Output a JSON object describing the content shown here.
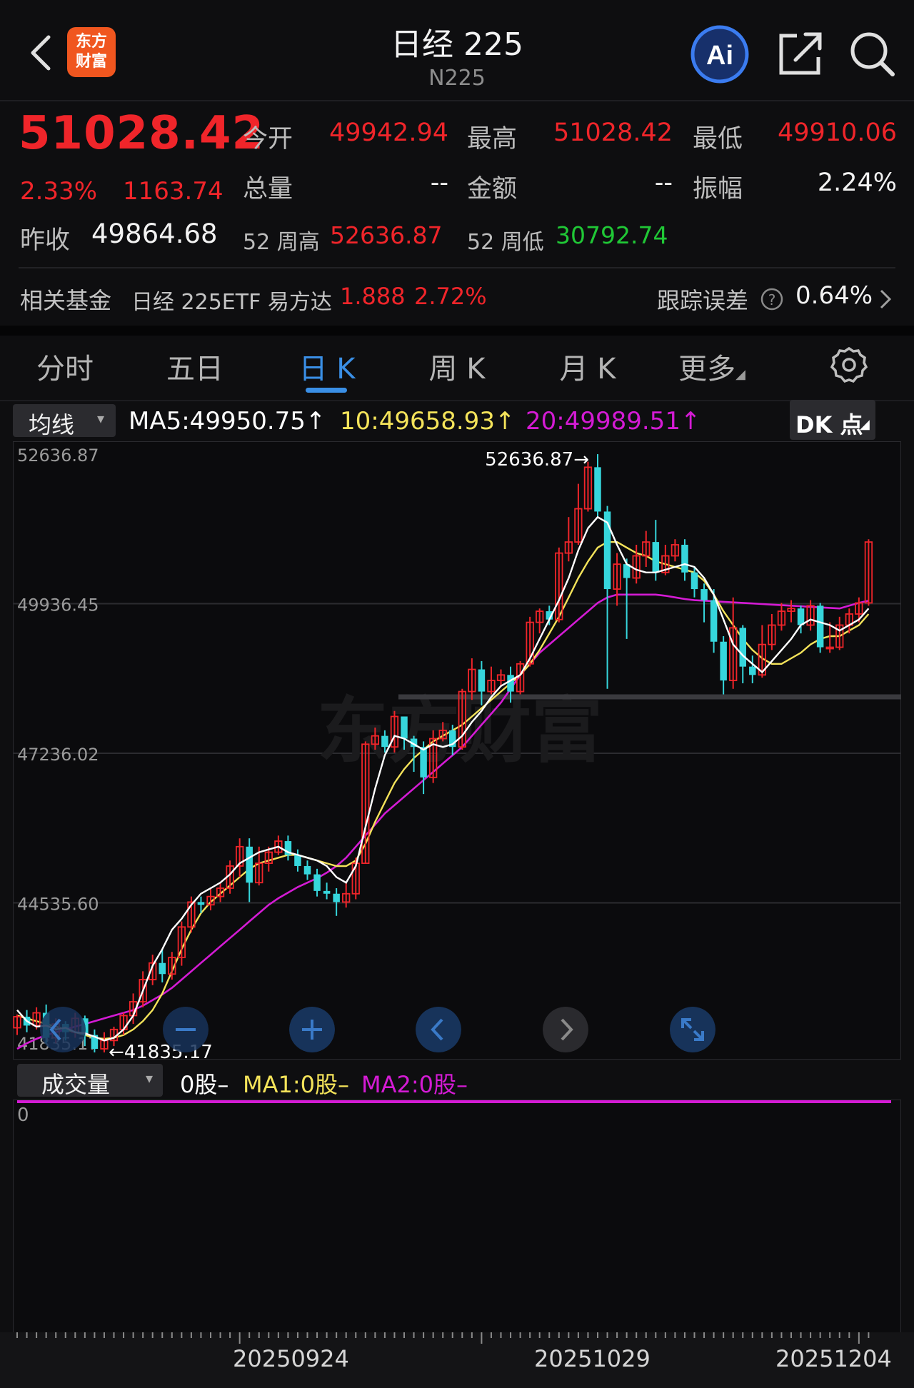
{
  "header": {
    "title": "日经 225",
    "subtitle": "N225",
    "logo_line1": "东方",
    "logo_line2": "财富",
    "ai_label": "Ai"
  },
  "quote": {
    "price": "51028.42",
    "change_pct": "2.33%",
    "change_abs": "1163.74",
    "open_label": "今开",
    "open": "49942.94",
    "high_label": "最高",
    "high": "51028.42",
    "low_label": "最低",
    "low": "49910.06",
    "volume_label": "总量",
    "volume": "--",
    "amount_label": "金额",
    "amount": "--",
    "amplitude_label": "振幅",
    "amplitude": "2.24%",
    "prev_close_label": "昨收",
    "prev_close": "49864.68",
    "w52_high_label": "52 周高",
    "w52_high": "52636.87",
    "w52_low_label": "52 周低",
    "w52_low": "30792.74"
  },
  "fund": {
    "label": "相关基金",
    "name": "日经 225ETF 易方达",
    "price": "1.888",
    "change": "2.72%",
    "tracking_label": "跟踪误差",
    "tracking_value": "0.64%"
  },
  "tabs": [
    "分时",
    "五日",
    "日 K",
    "周 K",
    "月 K",
    "更多"
  ],
  "active_tab": "日 K",
  "ma_bar": {
    "select": "均线",
    "ma5": "MA5:49950.75",
    "ma10": "10:49658.93",
    "ma20": "20:49989.51",
    "dk_button": "DK 点"
  },
  "colors": {
    "up": "#f0252a",
    "down": "#36d6dc",
    "ma5": "#ffffff",
    "ma10": "#f4e35a",
    "ma20": "#d41bd4",
    "accent": "#3a8fe6"
  },
  "chart_data": {
    "type": "candlestick",
    "y_labels": [
      "52636.87",
      "49936.45",
      "47236.02",
      "44535.60",
      "41835.17"
    ],
    "ylim": [
      41835.17,
      52636.87
    ],
    "max_annotation": "52636.87",
    "min_annotation": "41835.17",
    "x_labels": [
      "20250924",
      "20251029",
      "20251204"
    ],
    "candles": [
      [
        42280,
        42480,
        42150,
        42520
      ],
      [
        42480,
        42320,
        42200,
        42600
      ],
      [
        42320,
        42550,
        42250,
        42650
      ],
      [
        42550,
        42100,
        42000,
        42700
      ],
      [
        42100,
        42350,
        42000,
        42450
      ],
      [
        42350,
        42200,
        42050,
        42400
      ],
      [
        42200,
        42450,
        42100,
        42550
      ],
      [
        42450,
        42150,
        41950,
        42500
      ],
      [
        42150,
        41900,
        41835,
        42250
      ],
      [
        41900,
        42050,
        41835,
        42200
      ],
      [
        42050,
        42250,
        41950,
        42300
      ],
      [
        42250,
        42500,
        42150,
        42550
      ],
      [
        42500,
        42750,
        42350,
        42900
      ],
      [
        42750,
        43150,
        42650,
        43300
      ],
      [
        43150,
        43450,
        43050,
        43600
      ],
      [
        43450,
        43250,
        43100,
        43700
      ],
      [
        43250,
        43550,
        43150,
        43650
      ],
      [
        43550,
        44100,
        43400,
        44200
      ],
      [
        44100,
        44550,
        44000,
        44650
      ],
      [
        44550,
        44500,
        44350,
        44650
      ],
      [
        44500,
        44650,
        44400,
        44800
      ],
      [
        44650,
        44800,
        44550,
        44900
      ],
      [
        44800,
        45200,
        44700,
        45300
      ],
      [
        45200,
        45550,
        45000,
        45700
      ],
      [
        45550,
        44900,
        44550,
        45700
      ],
      [
        44900,
        45250,
        44850,
        45550
      ],
      [
        45250,
        45450,
        45100,
        45550
      ],
      [
        45450,
        45650,
        45400,
        45750
      ],
      [
        45650,
        45400,
        45300,
        45750
      ],
      [
        45400,
        45200,
        45100,
        45500
      ],
      [
        45200,
        45050,
        44950,
        45300
      ],
      [
        45050,
        44750,
        44650,
        45150
      ],
      [
        44750,
        44700,
        44600,
        44900
      ],
      [
        44700,
        44550,
        44300,
        44800
      ],
      [
        44550,
        44700,
        44450,
        44900
      ],
      [
        44700,
        45250,
        44600,
        45350
      ],
      [
        45250,
        47400,
        45250,
        47450
      ],
      [
        47400,
        47550,
        47300,
        47700
      ],
      [
        47550,
        47350,
        47250,
        47650
      ],
      [
        47350,
        47900,
        47250,
        48000
      ],
      [
        47900,
        47500,
        47300,
        47900
      ],
      [
        47500,
        47350,
        46900,
        47550
      ],
      [
        47350,
        46800,
        46500,
        47450
      ],
      [
        46800,
        47500,
        46700,
        47650
      ],
      [
        47500,
        47650,
        47450,
        47800
      ],
      [
        47650,
        47350,
        47200,
        47750
      ],
      [
        47350,
        48350,
        47300,
        48400
      ],
      [
        48350,
        48750,
        48200,
        48950
      ],
      [
        48750,
        48350,
        48100,
        48900
      ],
      [
        48350,
        48550,
        48300,
        48800
      ],
      [
        48550,
        48650,
        48450,
        48750
      ],
      [
        48650,
        48350,
        48150,
        48800
      ],
      [
        48350,
        48850,
        48300,
        48900
      ],
      [
        48850,
        49600,
        48800,
        49700
      ],
      [
        49600,
        49800,
        49400,
        49850
      ],
      [
        49800,
        49650,
        49550,
        49900
      ],
      [
        49650,
        50850,
        49600,
        50950
      ],
      [
        50850,
        51050,
        50700,
        51500
      ],
      [
        51050,
        51650,
        51000,
        52100
      ],
      [
        51650,
        52400,
        51600,
        52500
      ],
      [
        52400,
        51600,
        51500,
        52636
      ],
      [
        51600,
        50200,
        48400,
        51700
      ],
      [
        50200,
        50650,
        49900,
        50850
      ],
      [
        50650,
        50400,
        49300,
        50750
      ],
      [
        50400,
        50800,
        50300,
        51000
      ],
      [
        50800,
        51050,
        50600,
        51250
      ],
      [
        51050,
        50500,
        50350,
        51450
      ],
      [
        50500,
        50800,
        50450,
        51000
      ],
      [
        50800,
        51000,
        50700,
        51100
      ],
      [
        51000,
        50500,
        50350,
        51100
      ],
      [
        50500,
        50200,
        50050,
        50600
      ],
      [
        50200,
        50000,
        49600,
        50300
      ],
      [
        50000,
        49250,
        49050,
        50200
      ],
      [
        49250,
        48550,
        48300,
        49350
      ],
      [
        48550,
        49500,
        48400,
        50050
      ],
      [
        49500,
        48800,
        48500,
        49550
      ],
      [
        48800,
        48650,
        48500,
        49000
      ],
      [
        48650,
        49200,
        48600,
        49550
      ],
      [
        49200,
        49550,
        49100,
        49750
      ],
      [
        49550,
        49800,
        49450,
        49950
      ],
      [
        49800,
        49850,
        49600,
        50000
      ],
      [
        49850,
        49550,
        49400,
        49900
      ],
      [
        49550,
        49900,
        49450,
        50000
      ],
      [
        49900,
        49150,
        49050,
        49950
      ],
      [
        49150,
        49150,
        49050,
        49600
      ],
      [
        49150,
        49550,
        49100,
        49700
      ],
      [
        49550,
        49750,
        49400,
        49850
      ],
      [
        49750,
        49950,
        49600,
        50050
      ],
      [
        49950,
        51050,
        49900,
        51100
      ]
    ],
    "ma5": [
      42600,
      42400,
      42300,
      42320,
      42250,
      42280,
      42200,
      42180,
      42120,
      42050,
      42100,
      42250,
      42500,
      42950,
      43400,
      43700,
      44050,
      44250,
      44500,
      44700,
      44800,
      44900,
      45050,
      45250,
      45350,
      45450,
      45500,
      45550,
      45450,
      45400,
      45350,
      45300,
      45200,
      45000,
      44900,
      45200,
      45900,
      46600,
      47200,
      47550,
      47500,
      47400,
      47300,
      47400,
      47350,
      47400,
      47550,
      47800,
      48000,
      48250,
      48450,
      48550,
      48650,
      48950,
      49300,
      49650,
      50000,
      50400,
      50900,
      51300,
      51500,
      51400,
      51000,
      50650,
      50550,
      50500,
      50500,
      50550,
      50600,
      50650,
      50600,
      50400,
      50100,
      49650,
      49200,
      49000,
      48850,
      48700,
      48900,
      49100,
      49300,
      49550,
      49650,
      49600,
      49550,
      49450,
      49550,
      49650,
      49850
    ],
    "ma10": [
      42500,
      42450,
      42400,
      42350,
      42300,
      42250,
      42200,
      42150,
      42100,
      42080,
      42100,
      42150,
      42250,
      42400,
      42600,
      42900,
      43300,
      43700,
      44050,
      44350,
      44550,
      44700,
      44850,
      45000,
      45150,
      45250,
      45300,
      45350,
      45400,
      45400,
      45350,
      45300,
      45250,
      45200,
      45200,
      45300,
      45600,
      46000,
      46350,
      46700,
      46950,
      47150,
      47300,
      47450,
      47550,
      47650,
      47750,
      47900,
      48050,
      48200,
      48350,
      48500,
      48650,
      48850,
      49100,
      49400,
      49700,
      50050,
      50400,
      50700,
      50950,
      51050,
      51050,
      50950,
      50850,
      50800,
      50700,
      50650,
      50600,
      50550,
      50500,
      50350,
      50100,
      49800,
      49550,
      49300,
      49100,
      48950,
      48850,
      48850,
      48950,
      49050,
      49200,
      49300,
      49350,
      49350,
      49450,
      49550,
      49750
    ],
    "ma20": [
      41900,
      42000,
      42080,
      42150,
      42200,
      42250,
      42300,
      42350,
      42400,
      42450,
      42500,
      42550,
      42600,
      42680,
      42780,
      42880,
      43000,
      43150,
      43300,
      43450,
      43600,
      43750,
      43900,
      44050,
      44200,
      44350,
      44500,
      44620,
      44720,
      44820,
      44900,
      44980,
      45080,
      45200,
      45350,
      45550,
      45750,
      45950,
      46150,
      46300,
      46450,
      46600,
      46750,
      46900,
      47050,
      47200,
      47350,
      47550,
      47750,
      47950,
      48150,
      48400,
      48650,
      48850,
      49050,
      49200,
      49350,
      49500,
      49650,
      49800,
      49950,
      50050,
      50100,
      50100,
      50100,
      50100,
      50100,
      50080,
      50050,
      50020,
      50000,
      49990,
      49980,
      49970,
      49960,
      49950,
      49940,
      49930,
      49920,
      49910,
      49900,
      49890,
      49880,
      49870,
      49860,
      49850,
      49900,
      49950,
      49990
    ]
  },
  "volume": {
    "select": "成交量",
    "vol": "0股–",
    "ma1": "MA1:0股–",
    "ma2": "MA2:0股–",
    "axis_zero": "0"
  },
  "watermark": "东方财富"
}
